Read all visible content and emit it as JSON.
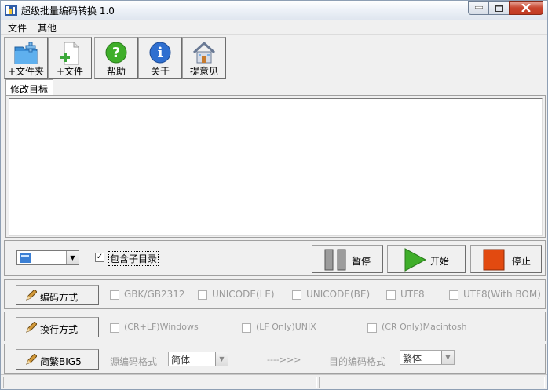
{
  "window": {
    "title": "超级批量编码转换 1.0"
  },
  "menu": {
    "file": "文件",
    "other": "其他"
  },
  "toolbar": {
    "add_folder": "+文件夹",
    "add_file": "+文件",
    "help": "帮助",
    "about": "关于",
    "feedback": "提意见"
  },
  "tab": {
    "label": "修改目标"
  },
  "controls": {
    "include_subdirs": "包含子目录",
    "include_subdirs_checked": true,
    "pause": "暂停",
    "start": "开始",
    "stop": "停止"
  },
  "encoding_row": {
    "button": "编码方式",
    "options": [
      "GBK/GB2312",
      "UNICODE(LE)",
      "UNICODE(BE)",
      "UTF8",
      "UTF8(With BOM)"
    ]
  },
  "newline_row": {
    "button": "换行方式",
    "options": [
      "(CR+LF)Windows",
      "(LF Only)UNIX",
      "(CR Only)Macintosh"
    ]
  },
  "big5_row": {
    "button": "简繁BIG5",
    "source_label": "源编码格式",
    "source_value": "简体",
    "arrow": "---->>>",
    "target_label": "目的编码格式",
    "target_value": "繁体"
  },
  "colors": {
    "start_green": "#3fae2a",
    "stop_orange": "#e24a10",
    "title_blue": "#1e5aa8"
  }
}
